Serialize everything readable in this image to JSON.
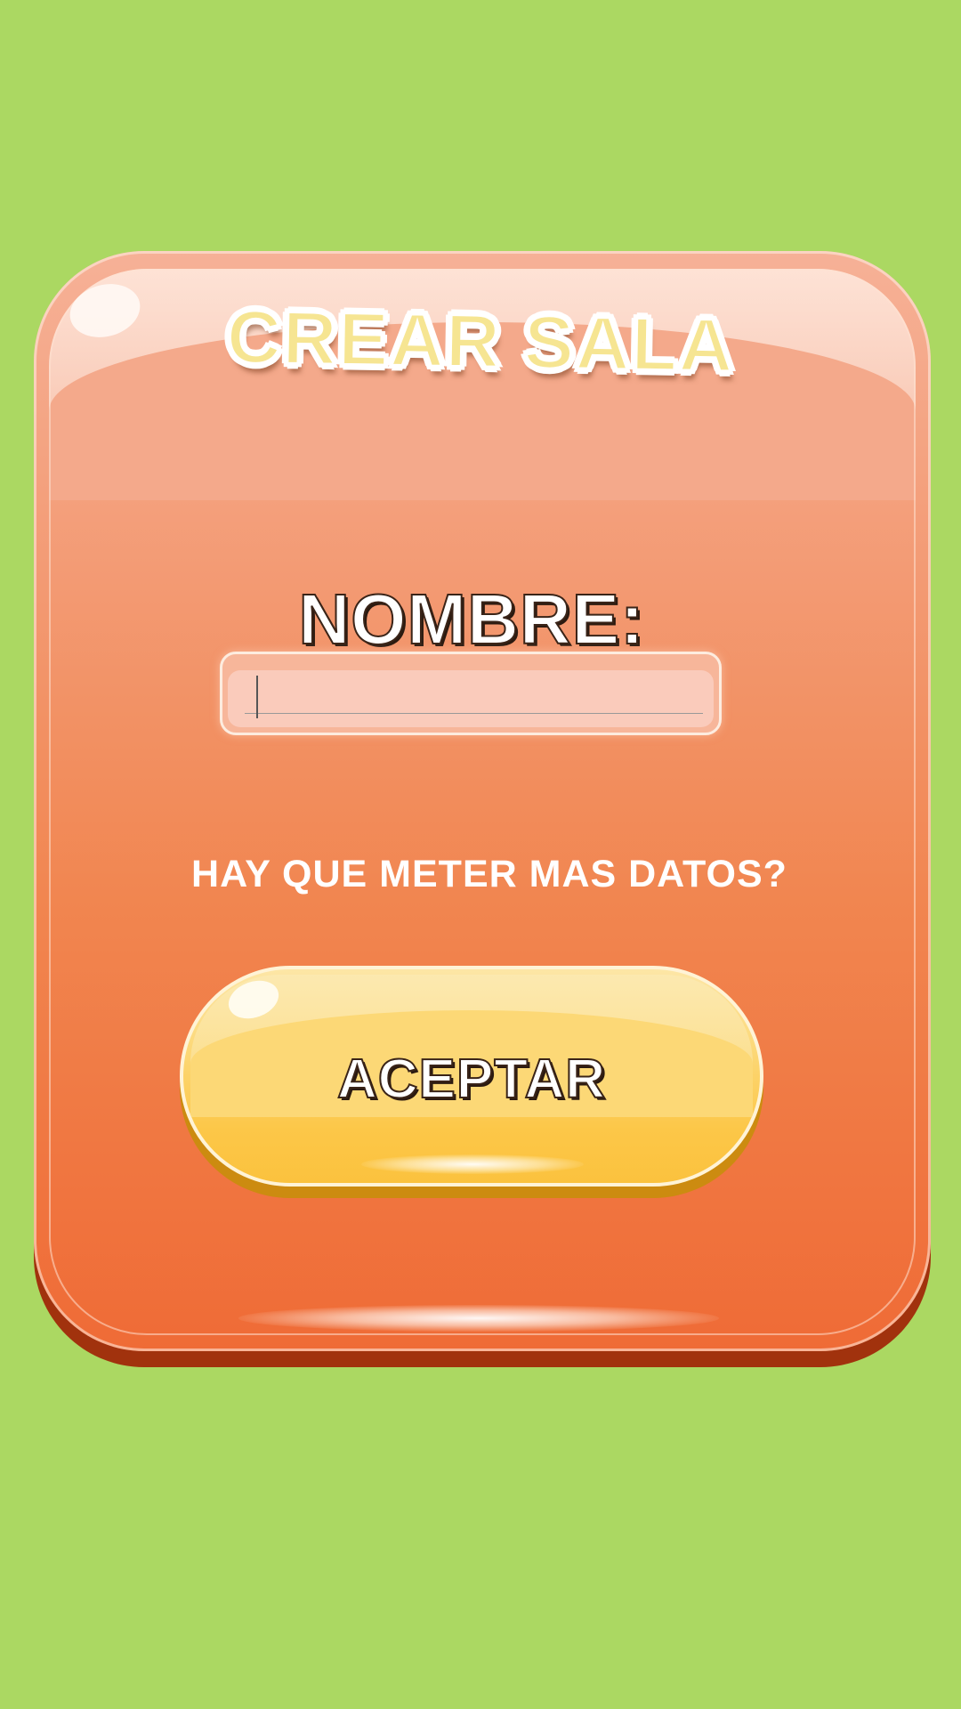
{
  "screen": {
    "background_color": "#abd862",
    "panel_color": "#ef6b36",
    "button_color": "#fbc23e"
  },
  "dialog": {
    "title": "CREAR SALA",
    "name_label": "NOMBRE:",
    "name_input": {
      "value": "",
      "placeholder": ""
    },
    "question": "HAY QUE METER MAS DATOS?",
    "accept_label": "ACEPTAR"
  }
}
